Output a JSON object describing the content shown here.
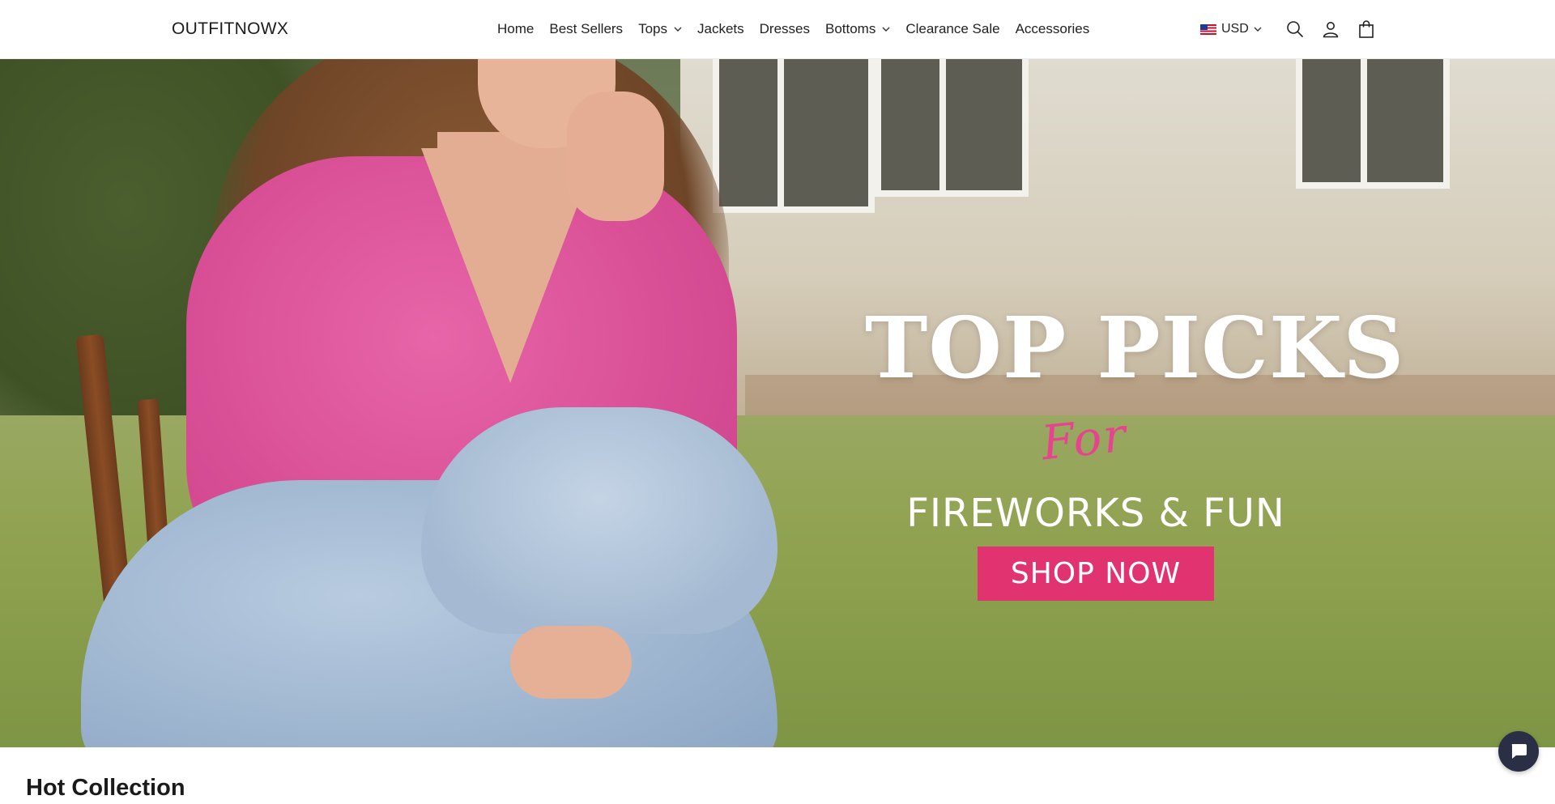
{
  "header": {
    "logo": "OUTFITNOWX",
    "nav": [
      {
        "label": "Home",
        "has_dropdown": false
      },
      {
        "label": "Best Sellers",
        "has_dropdown": false
      },
      {
        "label": "Tops",
        "has_dropdown": true
      },
      {
        "label": "Jackets",
        "has_dropdown": false
      },
      {
        "label": "Dresses",
        "has_dropdown": false
      },
      {
        "label": "Bottoms",
        "has_dropdown": true
      },
      {
        "label": "Clearance Sale",
        "has_dropdown": false
      },
      {
        "label": "Accessories",
        "has_dropdown": false
      }
    ],
    "currency": "USD",
    "icons": [
      "search-icon",
      "account-icon",
      "cart-icon"
    ]
  },
  "hero": {
    "title": "TOP PICKS",
    "script_word": "For",
    "subtitle": "FIREWORKS & FUN",
    "cta": "SHOP NOW",
    "cta_color": "#e0336f",
    "script_color": "#e7448f"
  },
  "sections": {
    "hot_collection": "Hot Collection"
  },
  "chat": {
    "icon": "chat-icon",
    "color": "#2a2f45"
  }
}
